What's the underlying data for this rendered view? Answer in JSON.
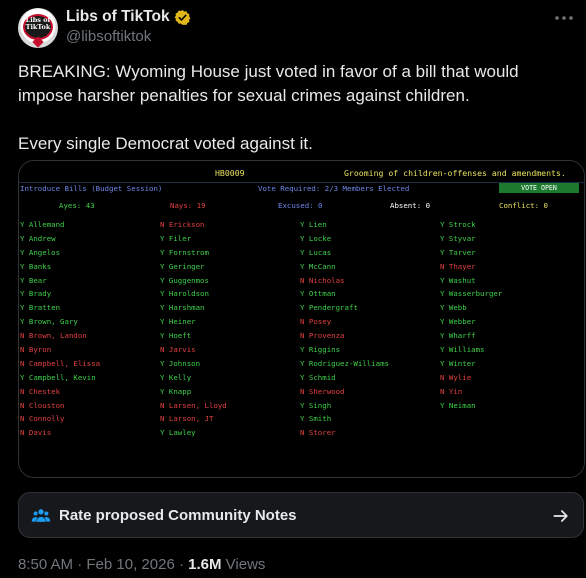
{
  "author": {
    "display_name": "Libs of TikTok",
    "handle": "@libsoftiktok",
    "avatar_text": "Libs of TikTok",
    "verified_icon": "verified-badge-gold",
    "verified_color": "#e2b719"
  },
  "tweet": {
    "paragraph_1": "BREAKING: Wyoming House just voted in favor of a bill that would impose harsher penalties for sexual crimes against children.",
    "paragraph_2": "Every single Democrat voted against it."
  },
  "vote_board": {
    "bill_number": "HB0009",
    "bill_title": "Grooming of children-offenses and amendments.",
    "session": "Introduce Bills (Budget Session)",
    "vote_required": "Vote Required: 2/3 Members Elected",
    "status": "VOTE OPEN",
    "tally": {
      "ayes": "Ayes: 43",
      "nays": "Nays: 19",
      "excused": "Excused: 0",
      "absent": "Absent: 0",
      "conflict": "Conflict: 0"
    },
    "colors": {
      "yes": "#3fd04a",
      "no": "#e04040",
      "header": "#e8e060",
      "info": "#6f86e8"
    },
    "columns": [
      [
        {
          "vote": "Y",
          "name": "Allemand"
        },
        {
          "vote": "Y",
          "name": "Andrew"
        },
        {
          "vote": "Y",
          "name": "Angelos"
        },
        {
          "vote": "Y",
          "name": "Banks"
        },
        {
          "vote": "Y",
          "name": "Bear"
        },
        {
          "vote": "Y",
          "name": "Brady"
        },
        {
          "vote": "Y",
          "name": "Bratten"
        },
        {
          "vote": "Y",
          "name": "Brown, Gary"
        },
        {
          "vote": "N",
          "name": "Brown, Landon"
        },
        {
          "vote": "N",
          "name": "Byron"
        },
        {
          "vote": "N",
          "name": "Campbell, Elissa"
        },
        {
          "vote": "Y",
          "name": "Campbell, Kevin"
        },
        {
          "vote": "N",
          "name": "Chestek"
        },
        {
          "vote": "N",
          "name": "Clouston"
        },
        {
          "vote": "N",
          "name": "Connolly"
        },
        {
          "vote": "N",
          "name": "Davis"
        }
      ],
      [
        {
          "vote": "N",
          "name": "Erickson"
        },
        {
          "vote": "Y",
          "name": "Filer"
        },
        {
          "vote": "Y",
          "name": "Fornstrom"
        },
        {
          "vote": "Y",
          "name": "Geringer"
        },
        {
          "vote": "Y",
          "name": "Guggenmos"
        },
        {
          "vote": "Y",
          "name": "Haroldson"
        },
        {
          "vote": "Y",
          "name": "Harshman"
        },
        {
          "vote": "Y",
          "name": "Heiner"
        },
        {
          "vote": "Y",
          "name": "Hoeft"
        },
        {
          "vote": "N",
          "name": "Jarvis"
        },
        {
          "vote": "Y",
          "name": "Johnson"
        },
        {
          "vote": "Y",
          "name": "Kelly"
        },
        {
          "vote": "Y",
          "name": "Knapp"
        },
        {
          "vote": "N",
          "name": "Larsen, Lloyd"
        },
        {
          "vote": "N",
          "name": "Larson, JT"
        },
        {
          "vote": "Y",
          "name": "Lawley"
        }
      ],
      [
        {
          "vote": "Y",
          "name": "Lien"
        },
        {
          "vote": "Y",
          "name": "Locke"
        },
        {
          "vote": "Y",
          "name": "Lucas"
        },
        {
          "vote": "Y",
          "name": "McCann"
        },
        {
          "vote": "N",
          "name": "Nicholas"
        },
        {
          "vote": "Y",
          "name": "Ottman"
        },
        {
          "vote": "Y",
          "name": "Pendergraft"
        },
        {
          "vote": "N",
          "name": "Posey"
        },
        {
          "vote": "N",
          "name": "Provenza"
        },
        {
          "vote": "Y",
          "name": "Riggins"
        },
        {
          "vote": "Y",
          "name": "Rodriguez-Williams"
        },
        {
          "vote": "Y",
          "name": "Schmid"
        },
        {
          "vote": "N",
          "name": "Sherwood"
        },
        {
          "vote": "Y",
          "name": "Singh"
        },
        {
          "vote": "Y",
          "name": "Smith"
        },
        {
          "vote": "N",
          "name": "Storer"
        }
      ],
      [
        {
          "vote": "Y",
          "name": "Strock"
        },
        {
          "vote": "Y",
          "name": "Styvar"
        },
        {
          "vote": "Y",
          "name": "Tarver"
        },
        {
          "vote": "N",
          "name": "Thayer"
        },
        {
          "vote": "Y",
          "name": "Washut"
        },
        {
          "vote": "Y",
          "name": "Wasserburger"
        },
        {
          "vote": "Y",
          "name": "Webb"
        },
        {
          "vote": "Y",
          "name": "Webber"
        },
        {
          "vote": "Y",
          "name": "Wharff"
        },
        {
          "vote": "Y",
          "name": "Williams"
        },
        {
          "vote": "Y",
          "name": "Winter"
        },
        {
          "vote": "N",
          "name": "Wylie"
        },
        {
          "vote": "N",
          "name": "Yin"
        },
        {
          "vote": "Y",
          "name": "Neiman"
        }
      ]
    ]
  },
  "community_notes": {
    "label": "Rate proposed Community Notes",
    "icon": "people-icon",
    "arrow_icon": "arrow-right-icon",
    "icon_color": "#1d9bf0"
  },
  "meta": {
    "time": "8:50 AM",
    "separator": "·",
    "date": "Feb 10, 2026",
    "views_count": "1.6M",
    "views_label": "Views"
  }
}
